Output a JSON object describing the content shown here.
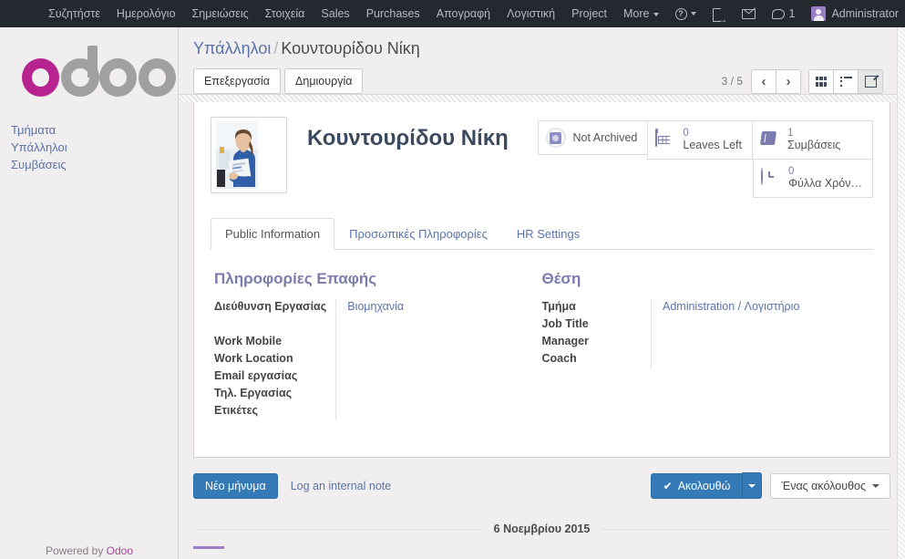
{
  "navbar": {
    "menus": [
      {
        "label": "Συζητήστε",
        "name": "nav-discuss"
      },
      {
        "label": "Ημερολόγιο",
        "name": "nav-calendar"
      },
      {
        "label": "Σημειώσεις",
        "name": "nav-notes"
      },
      {
        "label": "Στοιχεία",
        "name": "nav-contacts"
      },
      {
        "label": "Sales",
        "name": "nav-sales"
      },
      {
        "label": "Purchases",
        "name": "nav-purchases"
      },
      {
        "label": "Απογραφή",
        "name": "nav-inventory"
      },
      {
        "label": "Λογιστική",
        "name": "nav-accounting"
      },
      {
        "label": "Project",
        "name": "nav-project"
      },
      {
        "label": "More",
        "name": "nav-more"
      }
    ],
    "help_icon": "?",
    "messages_count": "1",
    "user": "Administrator",
    "icons": {
      "help": "help-icon",
      "signout": "signout-icon",
      "mail": "envelope-icon",
      "chat": "chat-bubble-icon",
      "avatar": "user-avatar-icon"
    }
  },
  "sidebar": {
    "logo_text": "odoo",
    "logo_accent_color": "#b8248f",
    "logo_gray_color": "#a0a0a0",
    "items": [
      {
        "label": "Τμήματα",
        "name": "sidebar-item-departments"
      },
      {
        "label": "Υπάλληλοι",
        "name": "sidebar-item-employees"
      },
      {
        "label": "Συμβάσεις",
        "name": "sidebar-item-contracts"
      }
    ],
    "powered_prefix": "Powered by ",
    "powered_brand": "Odoo"
  },
  "control_panel": {
    "breadcrumb_root": "Υπάλληλοι",
    "breadcrumb_sep": "/",
    "breadcrumb_current": "Κουντουρίδου Νίκη",
    "edit_label": "Επεξεργασία",
    "create_label": "Δημιουργία",
    "pager": "3 / 5",
    "prev_glyph": "‹",
    "next_glyph": "›",
    "views": [
      {
        "name": "view-kanban",
        "icon": "grid-icon",
        "active": false
      },
      {
        "name": "view-list",
        "icon": "list-icon",
        "active": false
      },
      {
        "name": "view-form",
        "icon": "pencil-icon",
        "active": true
      }
    ]
  },
  "employee": {
    "name": "Κουντουρίδου Νίκη",
    "photo_alt": "employee-photo",
    "stats": [
      {
        "name": "stat-archived",
        "icon": "archive-icon",
        "value": "",
        "label": "Not Archived"
      },
      {
        "name": "stat-leaves",
        "icon": "calendar-icon",
        "value": "0",
        "label": "Leaves Left"
      },
      {
        "name": "stat-contracts",
        "icon": "book-icon",
        "value": "1",
        "label": "Συμβάσεις"
      },
      {
        "name": "stat-timesheets",
        "icon": "clock-icon",
        "value": "0",
        "label": "Φύλλα Χρόν…"
      }
    ],
    "tabs": [
      {
        "label": "Public Information",
        "name": "tab-public-information",
        "active": true
      },
      {
        "label": "Προσωπικές Πληροφορίες",
        "name": "tab-personal-information",
        "active": false
      },
      {
        "label": "HR Settings",
        "name": "tab-hr-settings",
        "active": false
      }
    ],
    "contact_group": {
      "title": "Πληροφορίες Επαφής",
      "fields": [
        {
          "label": "Διεύθυνση Εργασίας",
          "value": "Βιομηχανία",
          "is_link": true,
          "name": "field-work-address"
        },
        {
          "label": "Work Mobile",
          "value": "",
          "is_link": false,
          "name": "field-work-mobile"
        },
        {
          "label": "Work Location",
          "value": "",
          "is_link": false,
          "name": "field-work-location"
        },
        {
          "label": "Email εργασίας",
          "value": "",
          "is_link": false,
          "name": "field-work-email"
        },
        {
          "label": "Τηλ. Εργασίας",
          "value": "",
          "is_link": false,
          "name": "field-work-phone"
        },
        {
          "label": "Ετικέτες",
          "value": "",
          "is_link": false,
          "name": "field-tags"
        }
      ]
    },
    "position_group": {
      "title": "Θέση",
      "fields": [
        {
          "label": "Τμήμα",
          "value": "Administration / Λογιστήριο",
          "is_link": true,
          "name": "field-department"
        },
        {
          "label": "Job Title",
          "value": "",
          "is_link": false,
          "name": "field-job-title"
        },
        {
          "label": "Manager",
          "value": "",
          "is_link": false,
          "name": "field-manager"
        },
        {
          "label": "Coach",
          "value": "",
          "is_link": false,
          "name": "field-coach"
        }
      ]
    }
  },
  "chatter": {
    "new_message_label": "Νέο μήνυμα",
    "internal_note_label": "Log an internal note",
    "follow_label": "Ακολουθώ",
    "follow_check": "✔",
    "followers_label": "Ένας ακόλουθος",
    "date_divider": "6 Νοεμβρίου 2015"
  },
  "colors": {
    "navbar_bg": "#23292f",
    "primary_blue": "#337ab7",
    "link_blue": "#5b73a8",
    "group_purple": "#7c7bad",
    "page_bg": "#f0eeee"
  }
}
